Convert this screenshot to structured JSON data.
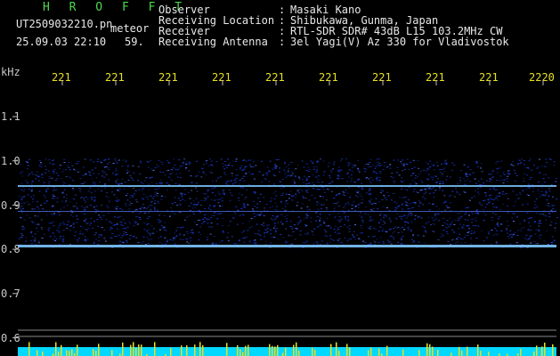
{
  "header": {
    "logo_text": "H R O F F T",
    "filename": "UT2509032210.pn",
    "tag": "meteor",
    "datetime": "25.09.03 22:10",
    "count": "59."
  },
  "info": {
    "rows": [
      {
        "label": "Observer",
        "sep": ":",
        "value": "Masaki Kano"
      },
      {
        "label": "Receiving Location",
        "sep": ":",
        "value": "Shibukawa, Gunma, Japan"
      },
      {
        "label": "Receiver",
        "sep": ":",
        "value": "RTL-SDR SDR# 43dB L15 103.2MHz CW"
      },
      {
        "label": "Receiving Antenna",
        "sep": ":",
        "value": "3el Yagi(V) Az 330 for Vladivostok"
      }
    ]
  },
  "axis": {
    "y_unit": "kHz",
    "y_ticks": [
      "1.1",
      "1.0",
      "0.9",
      "0.8",
      "0.7",
      "0.6"
    ],
    "x_ticks": [
      "221",
      "221",
      "221",
      "221",
      "221",
      "221",
      "221",
      "221",
      "221",
      "2220"
    ]
  },
  "colors": {
    "noise": "#1a3cd8",
    "line": "#7ec8ff",
    "bottom_bar": "#00d8ff",
    "bottom_spikes": "#e8e020"
  }
}
